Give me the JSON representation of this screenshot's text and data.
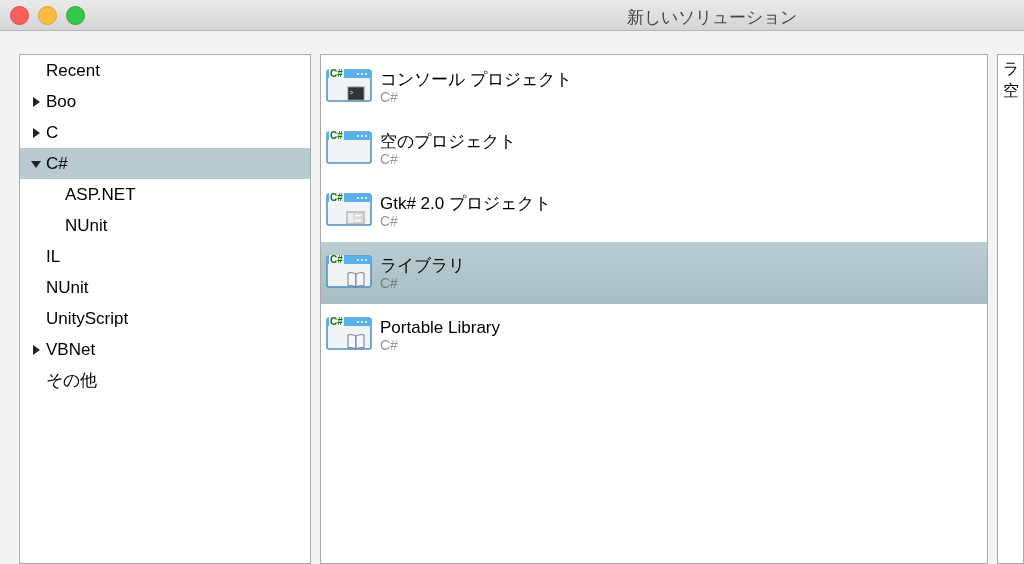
{
  "window": {
    "title": "新しいソリューション"
  },
  "categories": [
    {
      "label": "Recent",
      "selected": false
    },
    {
      "label": "Boo",
      "selected": false,
      "expanded": false
    },
    {
      "label": "C",
      "selected": false,
      "expanded": false
    },
    {
      "label": "C#",
      "selected": true,
      "expanded": true,
      "children": [
        {
          "label": "ASP.NET",
          "selected": false
        },
        {
          "label": "NUnit",
          "selected": false
        }
      ]
    },
    {
      "label": "IL",
      "selected": false
    },
    {
      "label": "NUnit",
      "selected": false
    },
    {
      "label": "UnityScript",
      "selected": false
    },
    {
      "label": "VBNet",
      "selected": false,
      "expanded": false
    },
    {
      "label": "その他",
      "selected": false
    }
  ],
  "templates": [
    {
      "name": "コンソール プロジェクト",
      "language": "C#",
      "icon_text": "C#",
      "kind": "console",
      "selected": false
    },
    {
      "name": "空のプロジェクト",
      "language": "C#",
      "icon_text": "C#",
      "kind": "blank",
      "selected": false
    },
    {
      "name": "Gtk# 2.0 プロジェクト",
      "language": "C#",
      "icon_text": "C#",
      "kind": "form",
      "selected": false
    },
    {
      "name": "ライブラリ",
      "language": "C#",
      "icon_text": "C#",
      "kind": "library",
      "selected": true
    },
    {
      "name": "Portable Library",
      "language": "C#",
      "icon_text": "C#",
      "kind": "library",
      "selected": false
    }
  ],
  "description": [
    "ラ",
    "空"
  ]
}
